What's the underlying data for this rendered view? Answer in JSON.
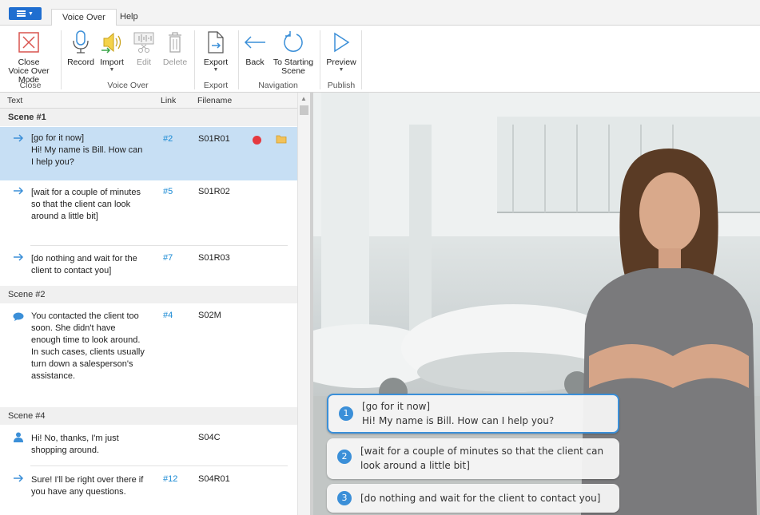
{
  "tabs": [
    {
      "label": "Voice Over",
      "active": true
    },
    {
      "label": "Help",
      "active": false
    }
  ],
  "ribbon": {
    "close_mode": "Close Voice Over Mode",
    "close_group": "Close",
    "record": "Record",
    "import": "Import",
    "edit": "Edit",
    "delete": "Delete",
    "voice_group": "Voice Over",
    "export": "Export",
    "export_group": "Export",
    "back": "Back",
    "to_starting": "To Starting Scene",
    "nav_group": "Navigation",
    "preview": "Preview",
    "publish_group": "Publish"
  },
  "table": {
    "headers": {
      "text": "Text",
      "link": "Link",
      "filename": "Filename"
    },
    "scenes": [
      {
        "title": "Scene #1"
      },
      {
        "title": "Scene #2"
      },
      {
        "title": "Scene #4"
      }
    ],
    "rows": [
      {
        "icon": "arrow-right-icon",
        "text": "[go for it now]\nHi! My name is Bill. How can I help you?",
        "link": "#2",
        "file": "S01R01"
      },
      {
        "icon": "arrow-right-icon",
        "text": "[wait for a couple of minutes so that the client can look around a little bit]",
        "link": "#5",
        "file": "S01R02"
      },
      {
        "icon": "arrow-right-icon",
        "text": "[do nothing and wait for the client to contact you]",
        "link": "#7",
        "file": "S01R03"
      },
      {
        "icon": "speech-bubble-icon",
        "text": "You contacted the client too soon. She didn't have enough time to look around. In such cases, clients usually turn down  a salesperson's assistance.",
        "link": "#4",
        "file": "S02M"
      },
      {
        "icon": "person-icon",
        "text": "Hi! No, thanks, I'm just shopping around.",
        "link": "",
        "file": "S04C"
      },
      {
        "icon": "arrow-right-icon",
        "text": "Sure! I'll be right over there if you have any questions.",
        "link": "#12",
        "file": "S04R01"
      }
    ]
  },
  "preview": {
    "choices": [
      {
        "num": "1",
        "text": "[go for it now]\nHi! My name is Bill. How can I help you?"
      },
      {
        "num": "2",
        "text": "[wait for a couple of minutes so that the client can look around a little bit]"
      },
      {
        "num": "3",
        "text": "[do nothing and wait for the client to contact you]"
      }
    ]
  },
  "colors": {
    "accent": "#3b8fd8",
    "selected_row": "#c7dff4",
    "record": "#e5393f",
    "link": "#1a8ad4"
  }
}
